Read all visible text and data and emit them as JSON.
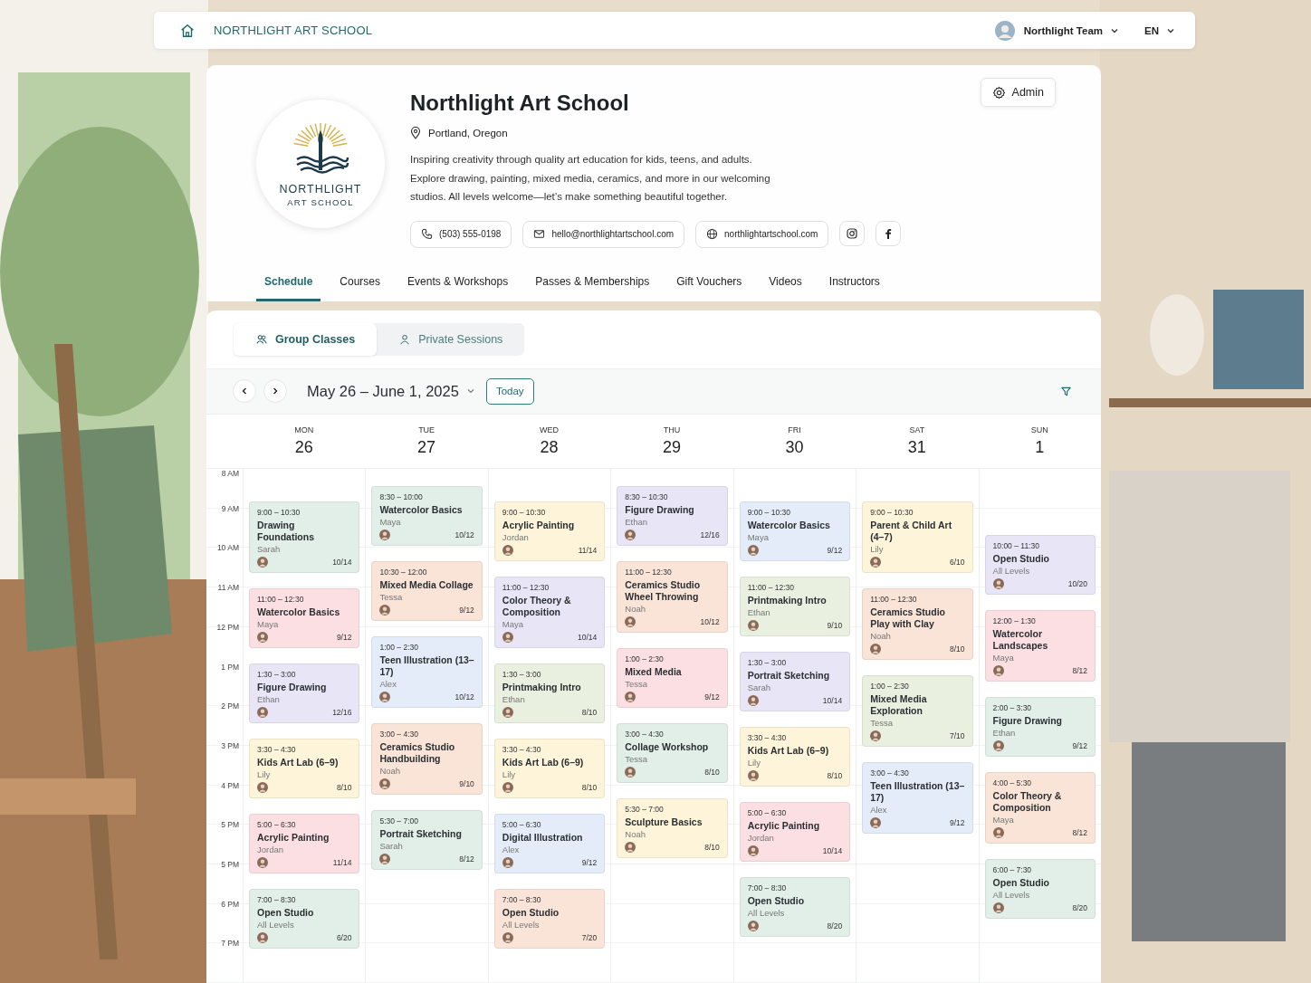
{
  "top_bar": {
    "brand": "NORTHLIGHT ART SCHOOL",
    "account": "Northlight Team",
    "language": "EN"
  },
  "school": {
    "logo_lines": [
      "NORTHLIGHT",
      "ART SCHOOL"
    ],
    "name": "Northlight Art School",
    "location": "Portland, Oregon",
    "description": [
      "Inspiring creativity through quality art education for kids, teens, and adults.",
      "Explore drawing, painting, mixed media, ceramics, and more in our welcoming",
      "studios. All levels welcome—let’s make something beautiful together."
    ],
    "contacts": [
      {
        "kind": "phone",
        "text": "(503) 555-0198"
      },
      {
        "kind": "email",
        "text": "hello@northlightartschool.com"
      },
      {
        "kind": "web",
        "text": "northlightartschool.com"
      }
    ],
    "socials": [
      {
        "kind": "instagram"
      },
      {
        "kind": "facebook"
      }
    ],
    "admin_button": "Admin"
  },
  "tabs": [
    {
      "label": "Schedule",
      "selected": true
    },
    {
      "label": "Courses",
      "selected": false
    },
    {
      "label": "Events & Workshops",
      "selected": false
    },
    {
      "label": "Passes & Memberships",
      "selected": false
    },
    {
      "label": "Gift Vouchers",
      "selected": false
    },
    {
      "label": "Videos",
      "selected": false
    },
    {
      "label": "Instructors",
      "selected": false
    }
  ],
  "session_types": [
    {
      "kind": "group",
      "label": "Group Classes",
      "selected": true
    },
    {
      "kind": "private",
      "label": "Private Sessions",
      "selected": false
    }
  ],
  "toolbar": {
    "range": "May 26 – June 1, 2025",
    "today_button": "Today"
  },
  "time_labels": [
    "8 AM",
    "9 AM",
    "10 AM",
    "11 AM",
    "12 PM",
    "1 PM",
    "2 PM",
    "3 PM",
    "4 PM",
    "5 PM",
    "5 PM",
    "6 PM",
    "7 PM"
  ],
  "days": [
    {
      "weekday": "MON",
      "date": "26",
      "events": [
        {
          "time": "9:00 – 10:30",
          "title": "Drawing Foundations",
          "instructor": "Sarah",
          "count": "10/14",
          "color": "#e2efe9"
        },
        {
          "time": "11:00 – 12:30",
          "title": "Watercolor Basics",
          "instructor": "Maya",
          "count": "9/12",
          "color": "#fbdfe2"
        },
        {
          "time": "1:30 – 3:00",
          "title": "Figure Drawing",
          "instructor": "Ethan",
          "count": "12/16",
          "color": "#e8e5f6"
        },
        {
          "time": "3:30 – 4:30",
          "title": "Kids Art Lab (6–9)",
          "instructor": "Lily",
          "count": "8/10",
          "color": "#fdf4d9"
        },
        {
          "time": "5:00 – 6:30",
          "title": "Acrylic Painting",
          "instructor": "Jordan",
          "count": "11/14",
          "color": "#fbdfe2"
        },
        {
          "time": "7:00 – 8:30",
          "title": "Open Studio",
          "instructor": "All Levels",
          "count": "6/20",
          "color": "#e2efe9"
        }
      ]
    },
    {
      "weekday": "TUE",
      "date": "27",
      "events": [
        {
          "time": "8:30 – 10:00",
          "title": "Watercolor Basics",
          "instructor": "Maya",
          "count": "10/12",
          "color": "#e2efe9"
        },
        {
          "time": "10:30 – 12:00",
          "title": "Mixed Media Collage",
          "instructor": "Tessa",
          "count": "9/12",
          "color": "#fae4d8"
        },
        {
          "time": "1:00 – 2:30",
          "title": "Teen Illustration (13–17)",
          "instructor": "Alex",
          "count": "10/12",
          "color": "#e3ecf8"
        },
        {
          "time": "3:00 – 4:30",
          "title": "Ceramics Studio Handbuilding",
          "instructor": "Noah",
          "count": "9/10",
          "color": "#fae4d8"
        },
        {
          "time": "5:30 – 7:00",
          "title": "Portrait Sketching",
          "instructor": "Sarah",
          "count": "8/12",
          "color": "#e2efe9"
        }
      ]
    },
    {
      "weekday": "WED",
      "date": "28",
      "events": [
        {
          "time": "9:00 – 10:30",
          "title": "Acrylic Painting",
          "instructor": "Jordan",
          "count": "11/14",
          "color": "#fdf4d9"
        },
        {
          "time": "11:00 – 12:30",
          "title": "Color Theory & Composition",
          "instructor": "Maya",
          "count": "10/14",
          "color": "#e8e5f6"
        },
        {
          "time": "1:30 – 3:00",
          "title": "Printmaking Intro",
          "instructor": "Ethan",
          "count": "8/10",
          "color": "#e9f0e0"
        },
        {
          "time": "3:30 – 4:30",
          "title": "Kids Art Lab (6–9)",
          "instructor": "Lily",
          "count": "8/10",
          "color": "#fdf4d9"
        },
        {
          "time": "5:00 – 6:30",
          "title": "Digital Illustration",
          "instructor": "Alex",
          "count": "9/12",
          "color": "#e3ecf8"
        },
        {
          "time": "7:00 – 8:30",
          "title": "Open Studio",
          "instructor": "All Levels",
          "count": "7/20",
          "color": "#fae4d8"
        }
      ]
    },
    {
      "weekday": "THU",
      "date": "29",
      "events": [
        {
          "time": "8:30 – 10:30",
          "title": "Figure Drawing",
          "instructor": "Ethan",
          "count": "12/16",
          "color": "#e8e5f6"
        },
        {
          "time": "11:00 – 12:30",
          "title": "Ceramics Studio Wheel Throwing",
          "instructor": "Noah",
          "count": "10/12",
          "color": "#fae4d8"
        },
        {
          "time": "1:00 – 2:30",
          "title": "Mixed Media",
          "instructor": "Tessa",
          "count": "9/12",
          "color": "#fbdfe2"
        },
        {
          "time": "3:00 – 4:30",
          "title": "Collage Workshop",
          "instructor": "Tessa",
          "count": "8/10",
          "color": "#e2efe9"
        },
        {
          "time": "5:30 – 7:00",
          "title": "Sculpture Basics",
          "instructor": "Noah",
          "count": "8/10",
          "color": "#fdf4d9"
        }
      ]
    },
    {
      "weekday": "FRI",
      "date": "30",
      "events": [
        {
          "time": "9:00 – 10:30",
          "title": "Watercolor Basics",
          "instructor": "Maya",
          "count": "9/12",
          "color": "#e3ecf8"
        },
        {
          "time": "11:00 – 12:30",
          "title": "Printmaking Intro",
          "instructor": "Ethan",
          "count": "9/10",
          "color": "#e9f0e0"
        },
        {
          "time": "1:30 – 3:00",
          "title": "Portrait Sketching",
          "instructor": "Sarah",
          "count": "10/14",
          "color": "#e8e5f6"
        },
        {
          "time": "3:30 – 4:30",
          "title": "Kids Art Lab (6–9)",
          "instructor": "Lily",
          "count": "8/10",
          "color": "#fdf4d9"
        },
        {
          "time": "5:00 – 6:30",
          "title": "Acrylic Painting",
          "instructor": "Jordan",
          "count": "10/14",
          "color": "#fbdfe2"
        },
        {
          "time": "7:00 – 8:30",
          "title": "Open Studio",
          "instructor": "All Levels",
          "count": "8/20",
          "color": "#e2efe9"
        }
      ]
    },
    {
      "weekday": "SAT",
      "date": "31",
      "events": [
        {
          "time": "9:00 – 10:30",
          "title": "Parent & Child Art (4–7)",
          "instructor": "Lily",
          "count": "6/10",
          "color": "#fdf4d9"
        },
        {
          "time": "11:00 – 12:30",
          "title": "Ceramics Studio Play with Clay",
          "instructor": "Noah",
          "count": "8/10",
          "color": "#fae4d8"
        },
        {
          "time": "1:00 – 2:30",
          "title": "Mixed Media Exploration",
          "instructor": "Tessa",
          "count": "7/10",
          "color": "#e9f0e0"
        },
        {
          "time": "3:00 – 4:30",
          "title": "Teen Illustration (13–17)",
          "instructor": "Alex",
          "count": "9/12",
          "color": "#e3ecf8"
        }
      ]
    },
    {
      "weekday": "SUN",
      "date": "1",
      "events": [
        {
          "time": "10:00 – 11:30",
          "title": "Open Studio",
          "instructor": "All Levels",
          "count": "10/20",
          "color": "#e8e5f6"
        },
        {
          "time": "12:00 – 1:30",
          "title": "Watercolor Landscapes",
          "instructor": "Maya",
          "count": "8/12",
          "color": "#fbdfe2"
        },
        {
          "time": "2:00 – 3:30",
          "title": "Figure Drawing",
          "instructor": "Ethan",
          "count": "9/12",
          "color": "#e2efe9"
        },
        {
          "time": "4:00 – 5:30",
          "title": "Color Theory & Composition",
          "instructor": "Maya",
          "count": "8/12",
          "color": "#fae4d8"
        },
        {
          "time": "6:00 – 7:30",
          "title": "Open Studio",
          "instructor": "All Levels",
          "count": "8/20",
          "color": "#e2efe9"
        }
      ]
    }
  ]
}
